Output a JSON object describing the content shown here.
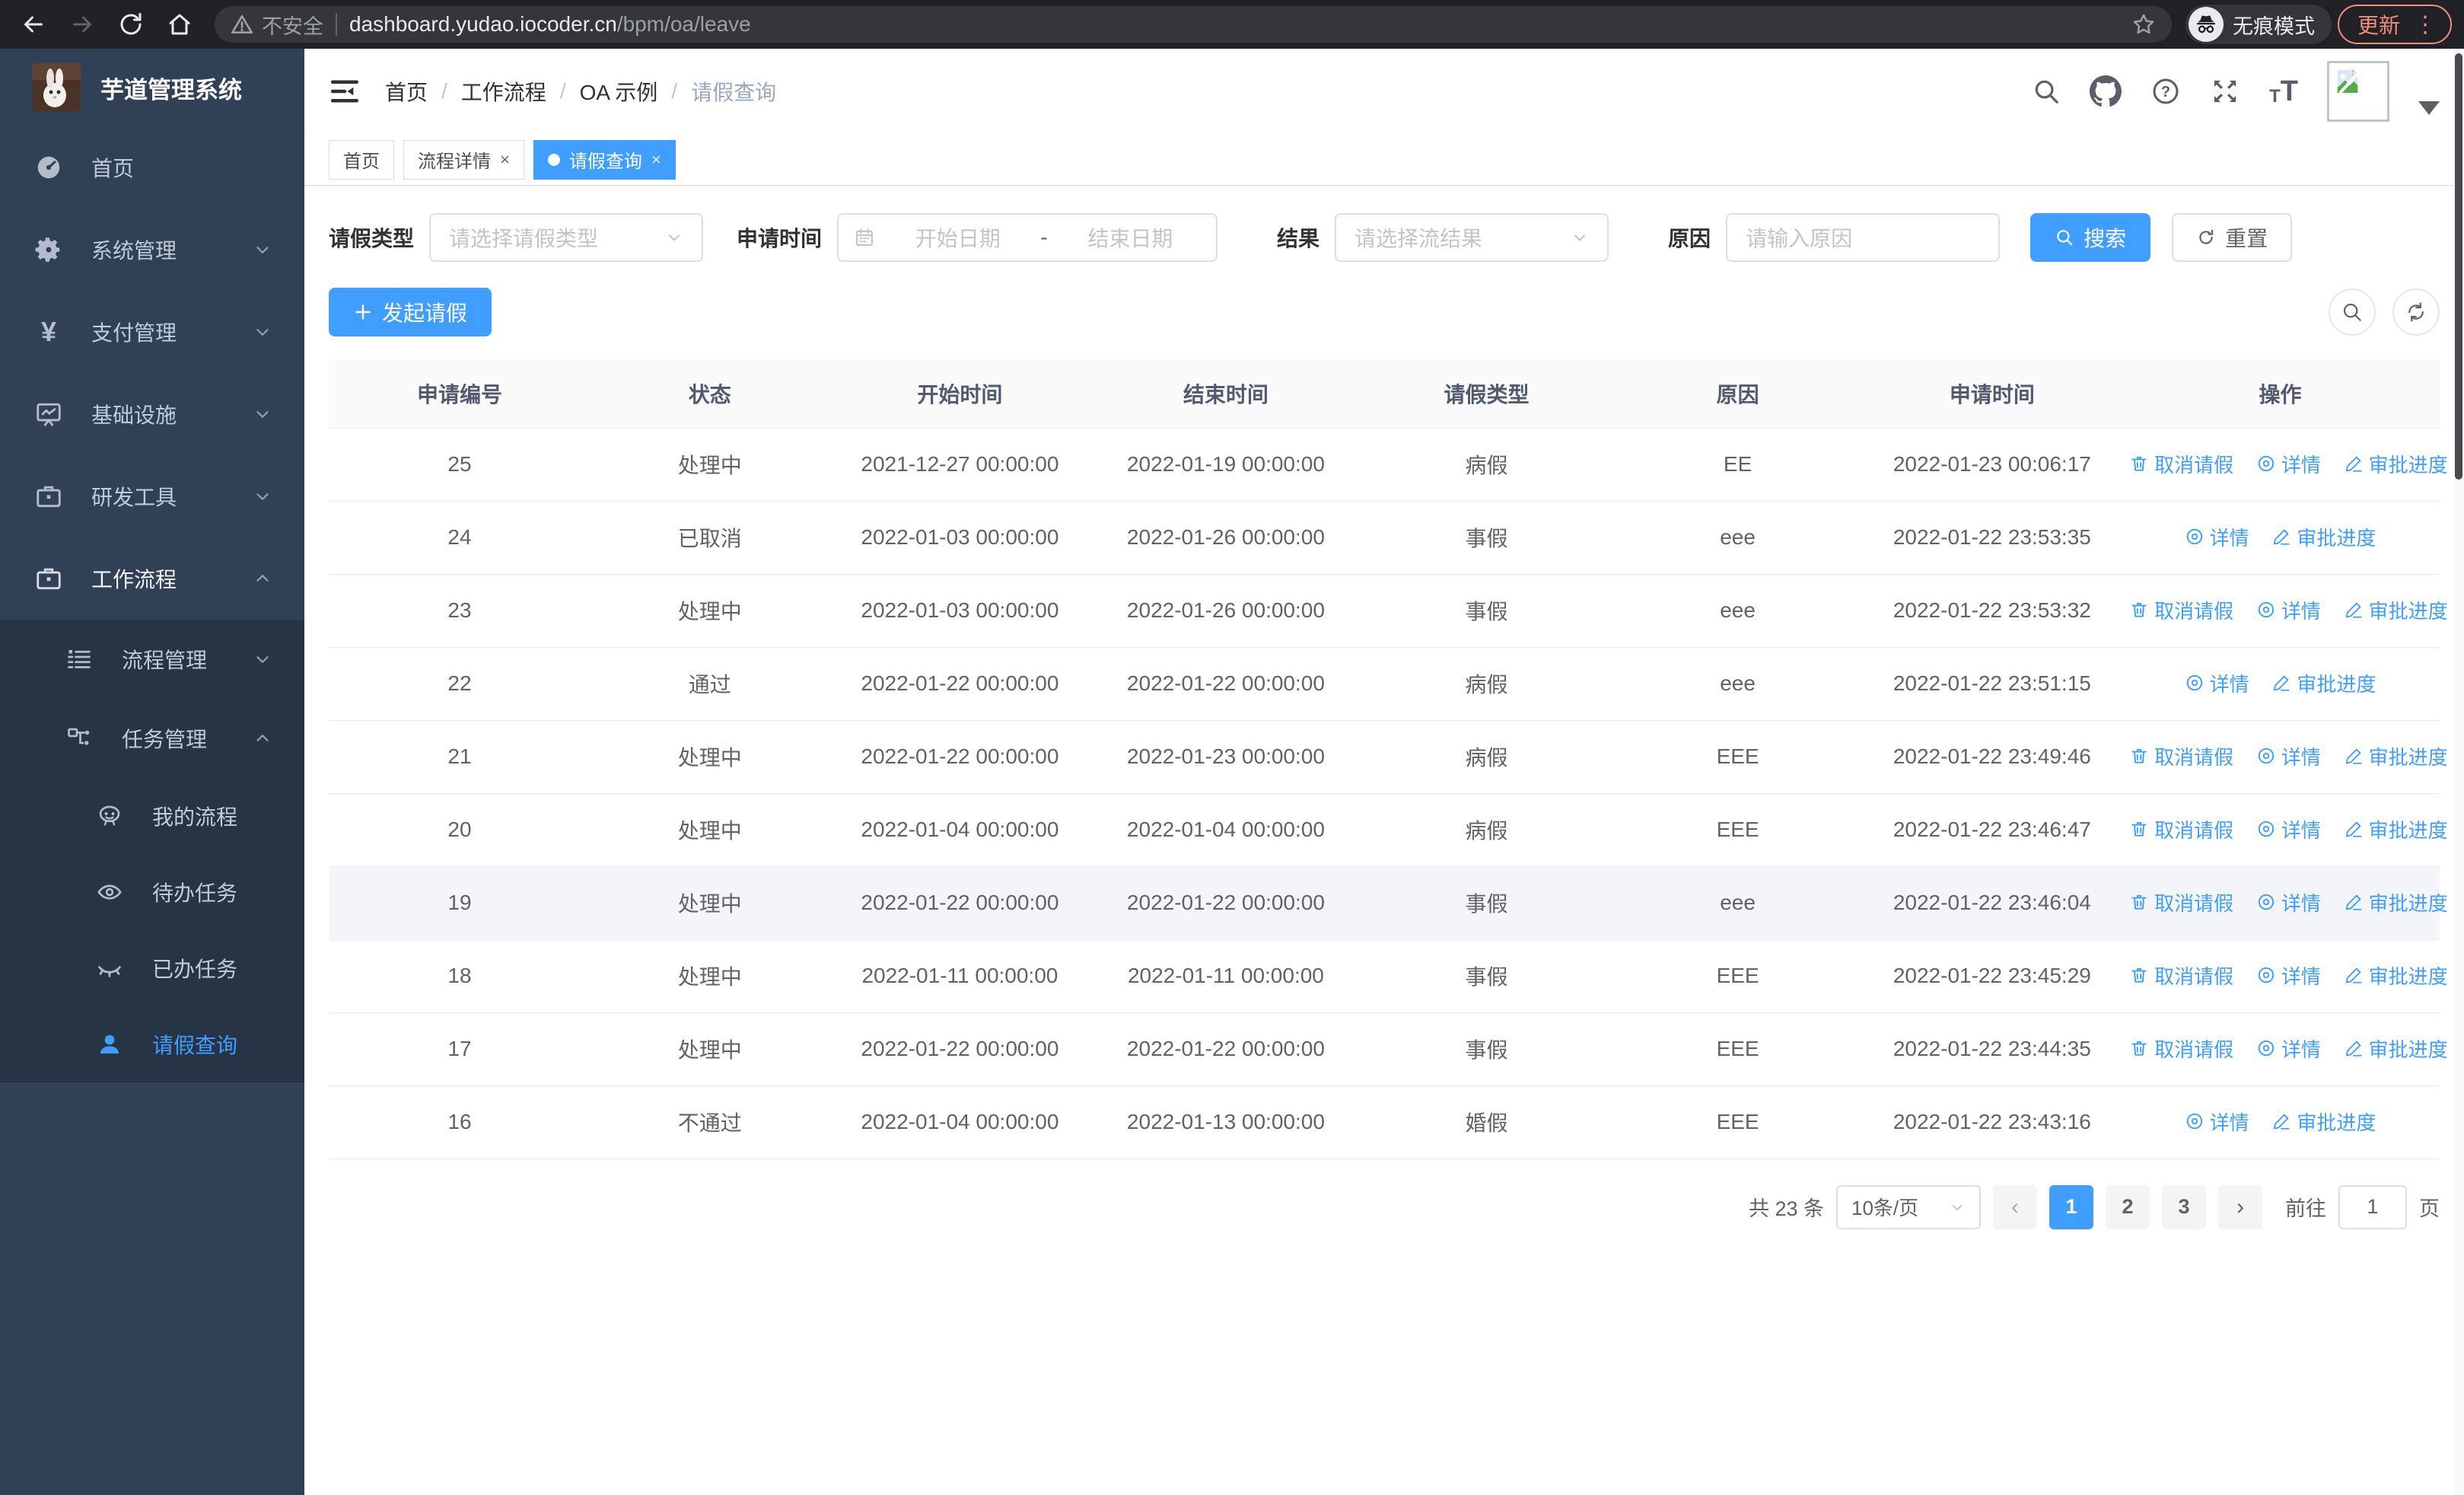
{
  "colors": {
    "accent": "#409eff",
    "sidebar_bg": "#304156",
    "submenu_bg": "#263445",
    "chrome_bg": "#202124",
    "update_red": "#f28b82"
  },
  "browser": {
    "security_label": "不安全",
    "url_host": "dashboard.yudao.iocoder.cn",
    "url_path": "/bpm/oa/leave",
    "incognito_label": "无痕模式",
    "update_label": "更新",
    "menu_dots": "⋮"
  },
  "sidebar": {
    "title": "芋道管理系统",
    "items": [
      {
        "label": "首页"
      },
      {
        "label": "系统管理"
      },
      {
        "label": "支付管理"
      },
      {
        "label": "基础设施"
      },
      {
        "label": "研发工具"
      },
      {
        "label": "工作流程"
      },
      {
        "label": "流程管理"
      },
      {
        "label": "任务管理"
      },
      {
        "label": "我的流程"
      },
      {
        "label": "待办任务"
      },
      {
        "label": "已办任务"
      },
      {
        "label": "请假查询"
      }
    ]
  },
  "breadcrumb": {
    "items": [
      "首页",
      "工作流程",
      "OA 示例",
      "请假查询"
    ],
    "separator": "/"
  },
  "tabs": [
    {
      "label": "首页",
      "closable": false,
      "active": false
    },
    {
      "label": "流程详情",
      "closable": true,
      "active": false
    },
    {
      "label": "请假查询",
      "closable": true,
      "active": true
    }
  ],
  "filters": {
    "leave_type_label": "请假类型",
    "leave_type_placeholder": "请选择请假类型",
    "apply_time_label": "申请时间",
    "date_start_placeholder": "开始日期",
    "date_separator": "-",
    "date_end_placeholder": "结束日期",
    "result_label": "结果",
    "result_placeholder": "请选择流结果",
    "reason_label": "原因",
    "reason_placeholder": "请输入原因",
    "search_label": "搜索",
    "reset_label": "重置"
  },
  "toolbar": {
    "create_label": "发起请假"
  },
  "table": {
    "columns": [
      "申请编号",
      "状态",
      "开始时间",
      "结束时间",
      "请假类型",
      "原因",
      "申请时间",
      "操作"
    ],
    "action_labels": {
      "cancel": "取消请假",
      "detail": "详情",
      "progress": "审批进度"
    },
    "rows": [
      {
        "id": "25",
        "status": "处理中",
        "start": "2021-12-27 00:00:00",
        "end": "2022-01-19 00:00:00",
        "type": "病假",
        "reason": "EE",
        "apply_time": "2022-01-23 00:06:17",
        "cancel": true,
        "hover": false
      },
      {
        "id": "24",
        "status": "已取消",
        "start": "2022-01-03 00:00:00",
        "end": "2022-01-26 00:00:00",
        "type": "事假",
        "reason": "eee",
        "apply_time": "2022-01-22 23:53:35",
        "cancel": false,
        "hover": false
      },
      {
        "id": "23",
        "status": "处理中",
        "start": "2022-01-03 00:00:00",
        "end": "2022-01-26 00:00:00",
        "type": "事假",
        "reason": "eee",
        "apply_time": "2022-01-22 23:53:32",
        "cancel": true,
        "hover": false
      },
      {
        "id": "22",
        "status": "通过",
        "start": "2022-01-22 00:00:00",
        "end": "2022-01-22 00:00:00",
        "type": "病假",
        "reason": "eee",
        "apply_time": "2022-01-22 23:51:15",
        "cancel": false,
        "hover": false
      },
      {
        "id": "21",
        "status": "处理中",
        "start": "2022-01-22 00:00:00",
        "end": "2022-01-23 00:00:00",
        "type": "病假",
        "reason": "EEE",
        "apply_time": "2022-01-22 23:49:46",
        "cancel": true,
        "hover": false
      },
      {
        "id": "20",
        "status": "处理中",
        "start": "2022-01-04 00:00:00",
        "end": "2022-01-04 00:00:00",
        "type": "病假",
        "reason": "EEE",
        "apply_time": "2022-01-22 23:46:47",
        "cancel": true,
        "hover": false
      },
      {
        "id": "19",
        "status": "处理中",
        "start": "2022-01-22 00:00:00",
        "end": "2022-01-22 00:00:00",
        "type": "事假",
        "reason": "eee",
        "apply_time": "2022-01-22 23:46:04",
        "cancel": true,
        "hover": true
      },
      {
        "id": "18",
        "status": "处理中",
        "start": "2022-01-11 00:00:00",
        "end": "2022-01-11 00:00:00",
        "type": "事假",
        "reason": "EEE",
        "apply_time": "2022-01-22 23:45:29",
        "cancel": true,
        "hover": false
      },
      {
        "id": "17",
        "status": "处理中",
        "start": "2022-01-22 00:00:00",
        "end": "2022-01-22 00:00:00",
        "type": "事假",
        "reason": "EEE",
        "apply_time": "2022-01-22 23:44:35",
        "cancel": true,
        "hover": false
      },
      {
        "id": "16",
        "status": "不通过",
        "start": "2022-01-04 00:00:00",
        "end": "2022-01-13 00:00:00",
        "type": "婚假",
        "reason": "EEE",
        "apply_time": "2022-01-22 23:43:16",
        "cancel": false,
        "hover": false
      }
    ]
  },
  "pagination": {
    "total_label": "共 23 条",
    "page_size": "10条/页",
    "pages": [
      "1",
      "2",
      "3"
    ],
    "active_page": "1",
    "prev": "‹",
    "next": "›",
    "goto_label": "前往",
    "goto_value": "1",
    "page_suffix": "页"
  }
}
